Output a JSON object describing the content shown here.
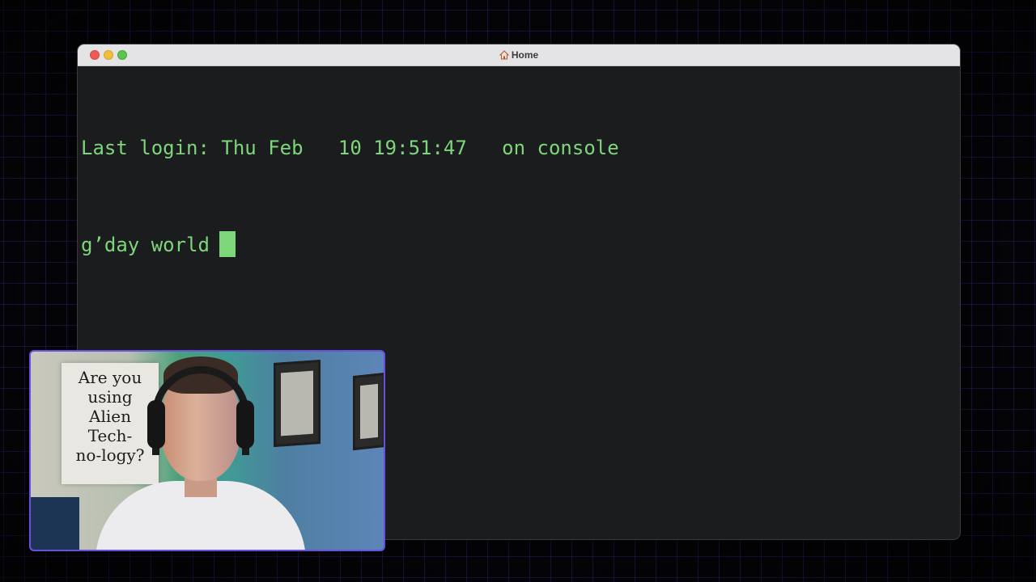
{
  "window": {
    "title": "Home",
    "title_icon": "home-icon"
  },
  "terminal": {
    "lines": [
      "Last login: Thu Feb   10 19:51:47   on console",
      "g’day world"
    ],
    "text_color": "#7ed67a",
    "background_color": "#1b1c1e"
  },
  "webcam": {
    "poster_text": "Are you\nusing\nAlien\nTech-\nno-logy?",
    "border_color": "#6b4fe0"
  },
  "background": {
    "grid_color": "#463cc8"
  }
}
